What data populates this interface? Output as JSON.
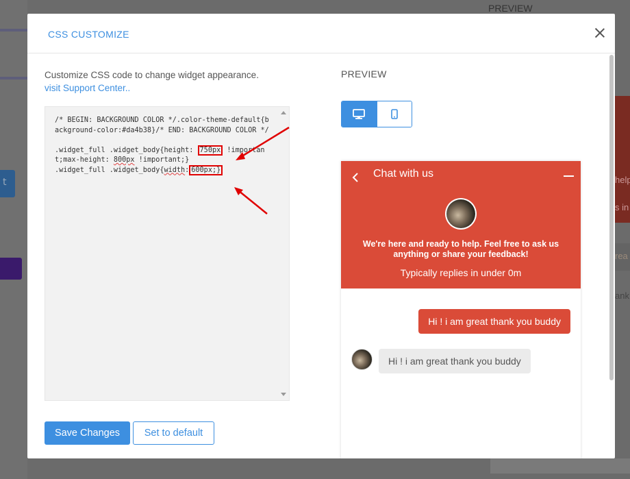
{
  "background": {
    "preview_label": "PREVIEW",
    "right_texts": [
      "help",
      "s in",
      "rea",
      "ank"
    ]
  },
  "modal": {
    "title": "CSS CUSTOMIZE",
    "intro_text": "Customize CSS code to change widget appearance.",
    "support_link": "visit Support Center..",
    "code": {
      "line1": "/* BEGIN: BACKGROUND COLOR */.color-theme-default{background-color:#da4b38}/* END: BACKGROUND COLOR */",
      "line2_pre": ".widget_full .widget_body{height: ",
      "line2_hl": "750px",
      "line2_mid": " !important;max-height: ",
      "line2_sq": "800px",
      "line2_post": " !important;}",
      "line3_pre": ".widget_full .widget_body{",
      "line3_sq": "width",
      "line3_colon": ":",
      "line3_hl": "600px;}"
    },
    "save_button": "Save Changes",
    "default_button": "Set to default",
    "preview_label": "PREVIEW",
    "device_toggle": {
      "desktop_icon": "desktop-icon",
      "mobile_icon": "mobile-icon",
      "active": "desktop"
    }
  },
  "widget": {
    "theme_color": "#da4b38",
    "title": "Chat with us",
    "welcome_text": "We're here and ready to help. Feel free to ask us anything or share your feedback!",
    "replies_text": "Typically replies in under 0m",
    "messages": [
      {
        "direction": "out",
        "text": "Hi ! i am great thank you buddy"
      },
      {
        "direction": "in",
        "text": "Hi ! i am great thank you buddy"
      }
    ]
  },
  "colors": {
    "accent": "#3d8fe0",
    "annotation": "#e00000"
  }
}
